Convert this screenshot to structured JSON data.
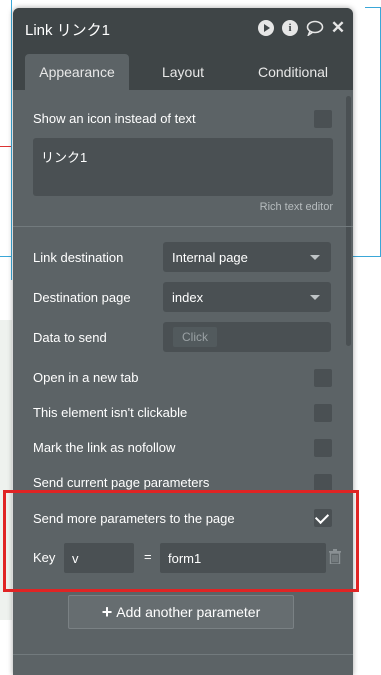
{
  "window": {
    "title": "Link リンク1"
  },
  "titlebar_icons": [
    "play-icon",
    "info-icon",
    "comment-icon",
    "close-icon"
  ],
  "tabs": [
    {
      "label": "Appearance",
      "active": true
    },
    {
      "label": "Layout",
      "active": false
    },
    {
      "label": "Conditional",
      "active": false
    }
  ],
  "show_icon": {
    "label": "Show an icon instead of text",
    "checked": false
  },
  "text_editor": {
    "value": "リンク1",
    "caption": "Rich text editor"
  },
  "link_destination": {
    "label": "Link destination",
    "value": "Internal page"
  },
  "destination_page": {
    "label": "Destination page",
    "value": "index"
  },
  "data_to_send": {
    "label": "Data to send",
    "button": "Click"
  },
  "open_new_tab": {
    "label": "Open in a new tab",
    "checked": false
  },
  "not_clickable": {
    "label": "This element isn't clickable",
    "checked": false
  },
  "nofollow": {
    "label": "Mark the link as nofollow",
    "checked": false
  },
  "send_current": {
    "label": "Send current page parameters",
    "checked": false
  },
  "send_more": {
    "label": "Send more parameters to the page",
    "checked": true
  },
  "parameter": {
    "key_label": "Key",
    "key_value": "v",
    "equals": "=",
    "value": "form1"
  },
  "add_param": {
    "label": "Add another parameter",
    "icon": "plus-icon"
  },
  "colors": {
    "panel": "#5c6366",
    "titlebar": "#3f4547",
    "highlight": "#e02424"
  }
}
